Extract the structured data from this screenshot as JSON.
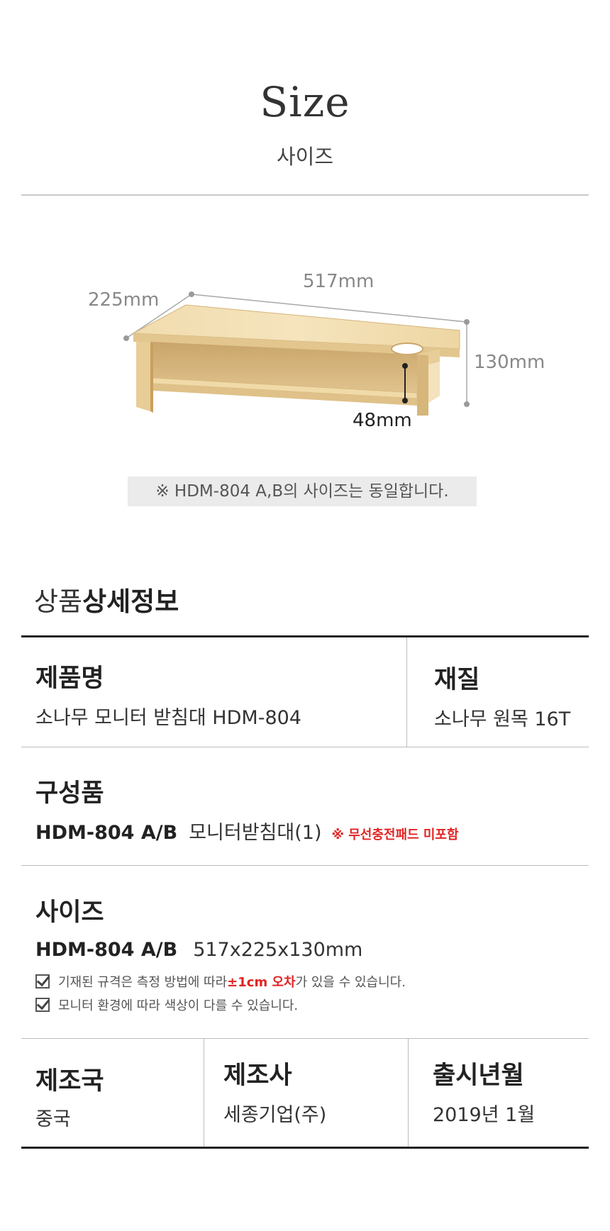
{
  "header": {
    "title_en": "Size",
    "title_ko": "사이즈"
  },
  "diagram": {
    "width_label": "517mm",
    "depth_label": "225mm",
    "height_label": "130mm",
    "inner_height_label": "48mm",
    "note": "※ HDM-804 A,B의 사이즈는 동일합니다."
  },
  "section": {
    "title_light": "상품",
    "title_bold": "상세정보"
  },
  "info": {
    "product_name_label": "제품명",
    "product_name_value": "소나무 모니터 받침대 HDM-804",
    "material_label": "재질",
    "material_value": "소나무 원목 16T",
    "components_label": "구성품",
    "components_model": "HDM-804 A/B",
    "components_value": "모니터받침대(1)",
    "components_note": "※ 무선충전패드 미포함",
    "size_label": "사이즈",
    "size_model": "HDM-804 A/B",
    "size_value": "517x225x130mm",
    "notice_1_before": "기재된 규격은 측정 방법에 따라 ",
    "notice_1_highlight": "±1cm 오차",
    "notice_1_after": "가 있을 수 있습니다.",
    "notice_2": "모니터 환경에 따라 색상이 다를 수 있습니다.",
    "country_label": "제조국",
    "country_value": "중국",
    "maker_label": "제조사",
    "maker_value": "세종기업(주)",
    "release_label": "출시년월",
    "release_value": "2019년 1월"
  }
}
